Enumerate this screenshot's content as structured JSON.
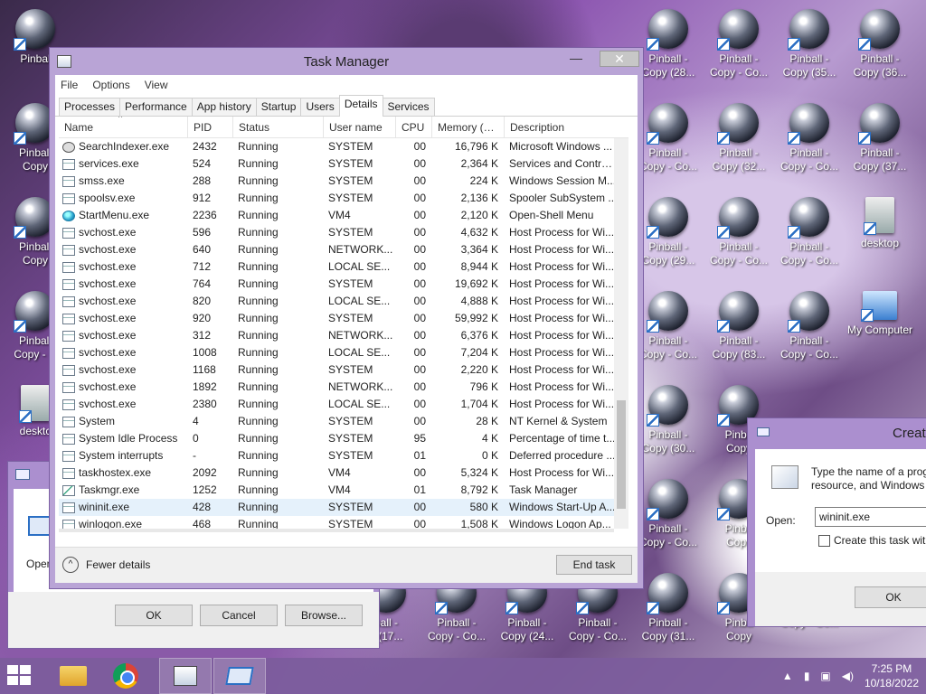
{
  "desktop_icons": [
    {
      "label": "Pinbal",
      "label2": ""
    },
    {
      "label": "Pinball",
      "label2": "Copy"
    },
    {
      "label": "Pinball",
      "label2": "Copy"
    },
    {
      "label": "Pinball",
      "label2": "Copy - C"
    },
    {
      "label": "desktc",
      "label2": ""
    },
    {
      "label": "Pinball -",
      "label2": "Copy (28..."
    },
    {
      "label": "Pinball -",
      "label2": "Copy - Co..."
    },
    {
      "label": "Pinball -",
      "label2": "Copy (35..."
    },
    {
      "label": "Pinball -",
      "label2": "Copy (36..."
    },
    {
      "label": "Pinball -",
      "label2": "Copy - Co..."
    },
    {
      "label": "Pinball -",
      "label2": "Copy (32..."
    },
    {
      "label": "Pinball -",
      "label2": "Copy - Co..."
    },
    {
      "label": "Pinball -",
      "label2": "Copy (37..."
    },
    {
      "label": "Pinball -",
      "label2": "Copy (29..."
    },
    {
      "label": "Pinball -",
      "label2": "Copy - Co..."
    },
    {
      "label": "Pinball -",
      "label2": "Copy - Co..."
    },
    {
      "label": "desktop",
      "label2": ""
    },
    {
      "label": "Pinball -",
      "label2": "Copy - Co..."
    },
    {
      "label": "Pinball -",
      "label2": "Copy (83..."
    },
    {
      "label": "Pinball -",
      "label2": "Copy - Co..."
    },
    {
      "label": "My Computer",
      "label2": ""
    },
    {
      "label": "Pinball -",
      "label2": "Copy (30..."
    },
    {
      "label": "Pinba",
      "label2": "Copy"
    },
    {
      "label": "Pinball -",
      "label2": "Copy - Co..."
    },
    {
      "label": "Pinba",
      "label2": "Copy"
    },
    {
      "label": "ball -",
      "label2": "y (17..."
    },
    {
      "label": "Pinball -",
      "label2": "Copy - Co..."
    },
    {
      "label": "Pinball -",
      "label2": "Copy (24..."
    },
    {
      "label": "Pinball -",
      "label2": "Copy - Co..."
    },
    {
      "label": "Pinball -",
      "label2": "Copy (31..."
    },
    {
      "label": "Pinba",
      "label2": "Copy"
    },
    {
      "label": "",
      "label2": "Copy - Co..."
    }
  ],
  "task_manager": {
    "title": "Task Manager",
    "minimize": "—",
    "close": "✕",
    "menu": [
      "File",
      "Options",
      "View"
    ],
    "tabs": [
      "Processes",
      "Performance",
      "App history",
      "Startup",
      "Users",
      "Details",
      "Services"
    ],
    "active_tab": "Details",
    "columns": [
      "Name",
      "PID",
      "Status",
      "User name",
      "CPU",
      "Memory (p...",
      "Description"
    ],
    "sort_glyph": "^",
    "rows": [
      {
        "name": "SearchIndexer.exe",
        "pid": "2432",
        "status": "Running",
        "user": "SYSTEM",
        "cpu": "00",
        "mem": "16,796 K",
        "desc": "Microsoft Windows ...",
        "icon": "mag"
      },
      {
        "name": "services.exe",
        "pid": "524",
        "status": "Running",
        "user": "SYSTEM",
        "cpu": "00",
        "mem": "2,364 K",
        "desc": "Services and Control..."
      },
      {
        "name": "smss.exe",
        "pid": "288",
        "status": "Running",
        "user": "SYSTEM",
        "cpu": "00",
        "mem": "224 K",
        "desc": "Windows Session M..."
      },
      {
        "name": "spoolsv.exe",
        "pid": "912",
        "status": "Running",
        "user": "SYSTEM",
        "cpu": "00",
        "mem": "2,136 K",
        "desc": "Spooler SubSystem ..."
      },
      {
        "name": "StartMenu.exe",
        "pid": "2236",
        "status": "Running",
        "user": "VM4",
        "cpu": "00",
        "mem": "2,120 K",
        "desc": "Open-Shell Menu",
        "icon": "globe"
      },
      {
        "name": "svchost.exe",
        "pid": "596",
        "status": "Running",
        "user": "SYSTEM",
        "cpu": "00",
        "mem": "4,632 K",
        "desc": "Host Process for Wi..."
      },
      {
        "name": "svchost.exe",
        "pid": "640",
        "status": "Running",
        "user": "NETWORK...",
        "cpu": "00",
        "mem": "3,364 K",
        "desc": "Host Process for Wi..."
      },
      {
        "name": "svchost.exe",
        "pid": "712",
        "status": "Running",
        "user": "LOCAL SE...",
        "cpu": "00",
        "mem": "8,944 K",
        "desc": "Host Process for Wi..."
      },
      {
        "name": "svchost.exe",
        "pid": "764",
        "status": "Running",
        "user": "SYSTEM",
        "cpu": "00",
        "mem": "19,692 K",
        "desc": "Host Process for Wi..."
      },
      {
        "name": "svchost.exe",
        "pid": "820",
        "status": "Running",
        "user": "LOCAL SE...",
        "cpu": "00",
        "mem": "4,888 K",
        "desc": "Host Process for Wi..."
      },
      {
        "name": "svchost.exe",
        "pid": "920",
        "status": "Running",
        "user": "SYSTEM",
        "cpu": "00",
        "mem": "59,992 K",
        "desc": "Host Process for Wi..."
      },
      {
        "name": "svchost.exe",
        "pid": "312",
        "status": "Running",
        "user": "NETWORK...",
        "cpu": "00",
        "mem": "6,376 K",
        "desc": "Host Process for Wi..."
      },
      {
        "name": "svchost.exe",
        "pid": "1008",
        "status": "Running",
        "user": "LOCAL SE...",
        "cpu": "00",
        "mem": "7,204 K",
        "desc": "Host Process for Wi..."
      },
      {
        "name": "svchost.exe",
        "pid": "1168",
        "status": "Running",
        "user": "SYSTEM",
        "cpu": "00",
        "mem": "2,220 K",
        "desc": "Host Process for Wi..."
      },
      {
        "name": "svchost.exe",
        "pid": "1892",
        "status": "Running",
        "user": "NETWORK...",
        "cpu": "00",
        "mem": "796 K",
        "desc": "Host Process for Wi..."
      },
      {
        "name": "svchost.exe",
        "pid": "2380",
        "status": "Running",
        "user": "LOCAL SE...",
        "cpu": "00",
        "mem": "1,704 K",
        "desc": "Host Process for Wi..."
      },
      {
        "name": "System",
        "pid": "4",
        "status": "Running",
        "user": "SYSTEM",
        "cpu": "00",
        "mem": "28 K",
        "desc": "NT Kernel & System"
      },
      {
        "name": "System Idle Process",
        "pid": "0",
        "status": "Running",
        "user": "SYSTEM",
        "cpu": "95",
        "mem": "4 K",
        "desc": "Percentage of time t..."
      },
      {
        "name": "System interrupts",
        "pid": "-",
        "status": "Running",
        "user": "SYSTEM",
        "cpu": "01",
        "mem": "0 K",
        "desc": "Deferred procedure ..."
      },
      {
        "name": "taskhostex.exe",
        "pid": "2092",
        "status": "Running",
        "user": "VM4",
        "cpu": "00",
        "mem": "5,324 K",
        "desc": "Host Process for Wi..."
      },
      {
        "name": "Taskmgr.exe",
        "pid": "1252",
        "status": "Running",
        "user": "VM4",
        "cpu": "01",
        "mem": "8,792 K",
        "desc": "Task Manager",
        "icon": "task"
      },
      {
        "name": "wininit.exe",
        "pid": "428",
        "status": "Running",
        "user": "SYSTEM",
        "cpu": "00",
        "mem": "580 K",
        "desc": "Windows Start-Up A...",
        "selected": true
      },
      {
        "name": "winlogon.exe",
        "pid": "468",
        "status": "Running",
        "user": "SYSTEM",
        "cpu": "00",
        "mem": "1,508 K",
        "desc": "Windows Logon Ap..."
      }
    ],
    "fewer_details": "Fewer details",
    "fewer_glyph": "^",
    "end_task": "End task"
  },
  "run_back": {
    "open_label": "Open",
    "ok": "OK",
    "cancel": "Cancel",
    "browse": "Browse..."
  },
  "run_front": {
    "title": "Create",
    "text_line1": "Type the name of a prog",
    "text_line2": "resource, and Windows v",
    "open_label": "Open:",
    "open_value": "wininit.exe",
    "checkbox_label": "Create this task with",
    "ok": "OK"
  },
  "taskbar": {
    "time": "7:25 PM",
    "date": "10/18/2022"
  }
}
